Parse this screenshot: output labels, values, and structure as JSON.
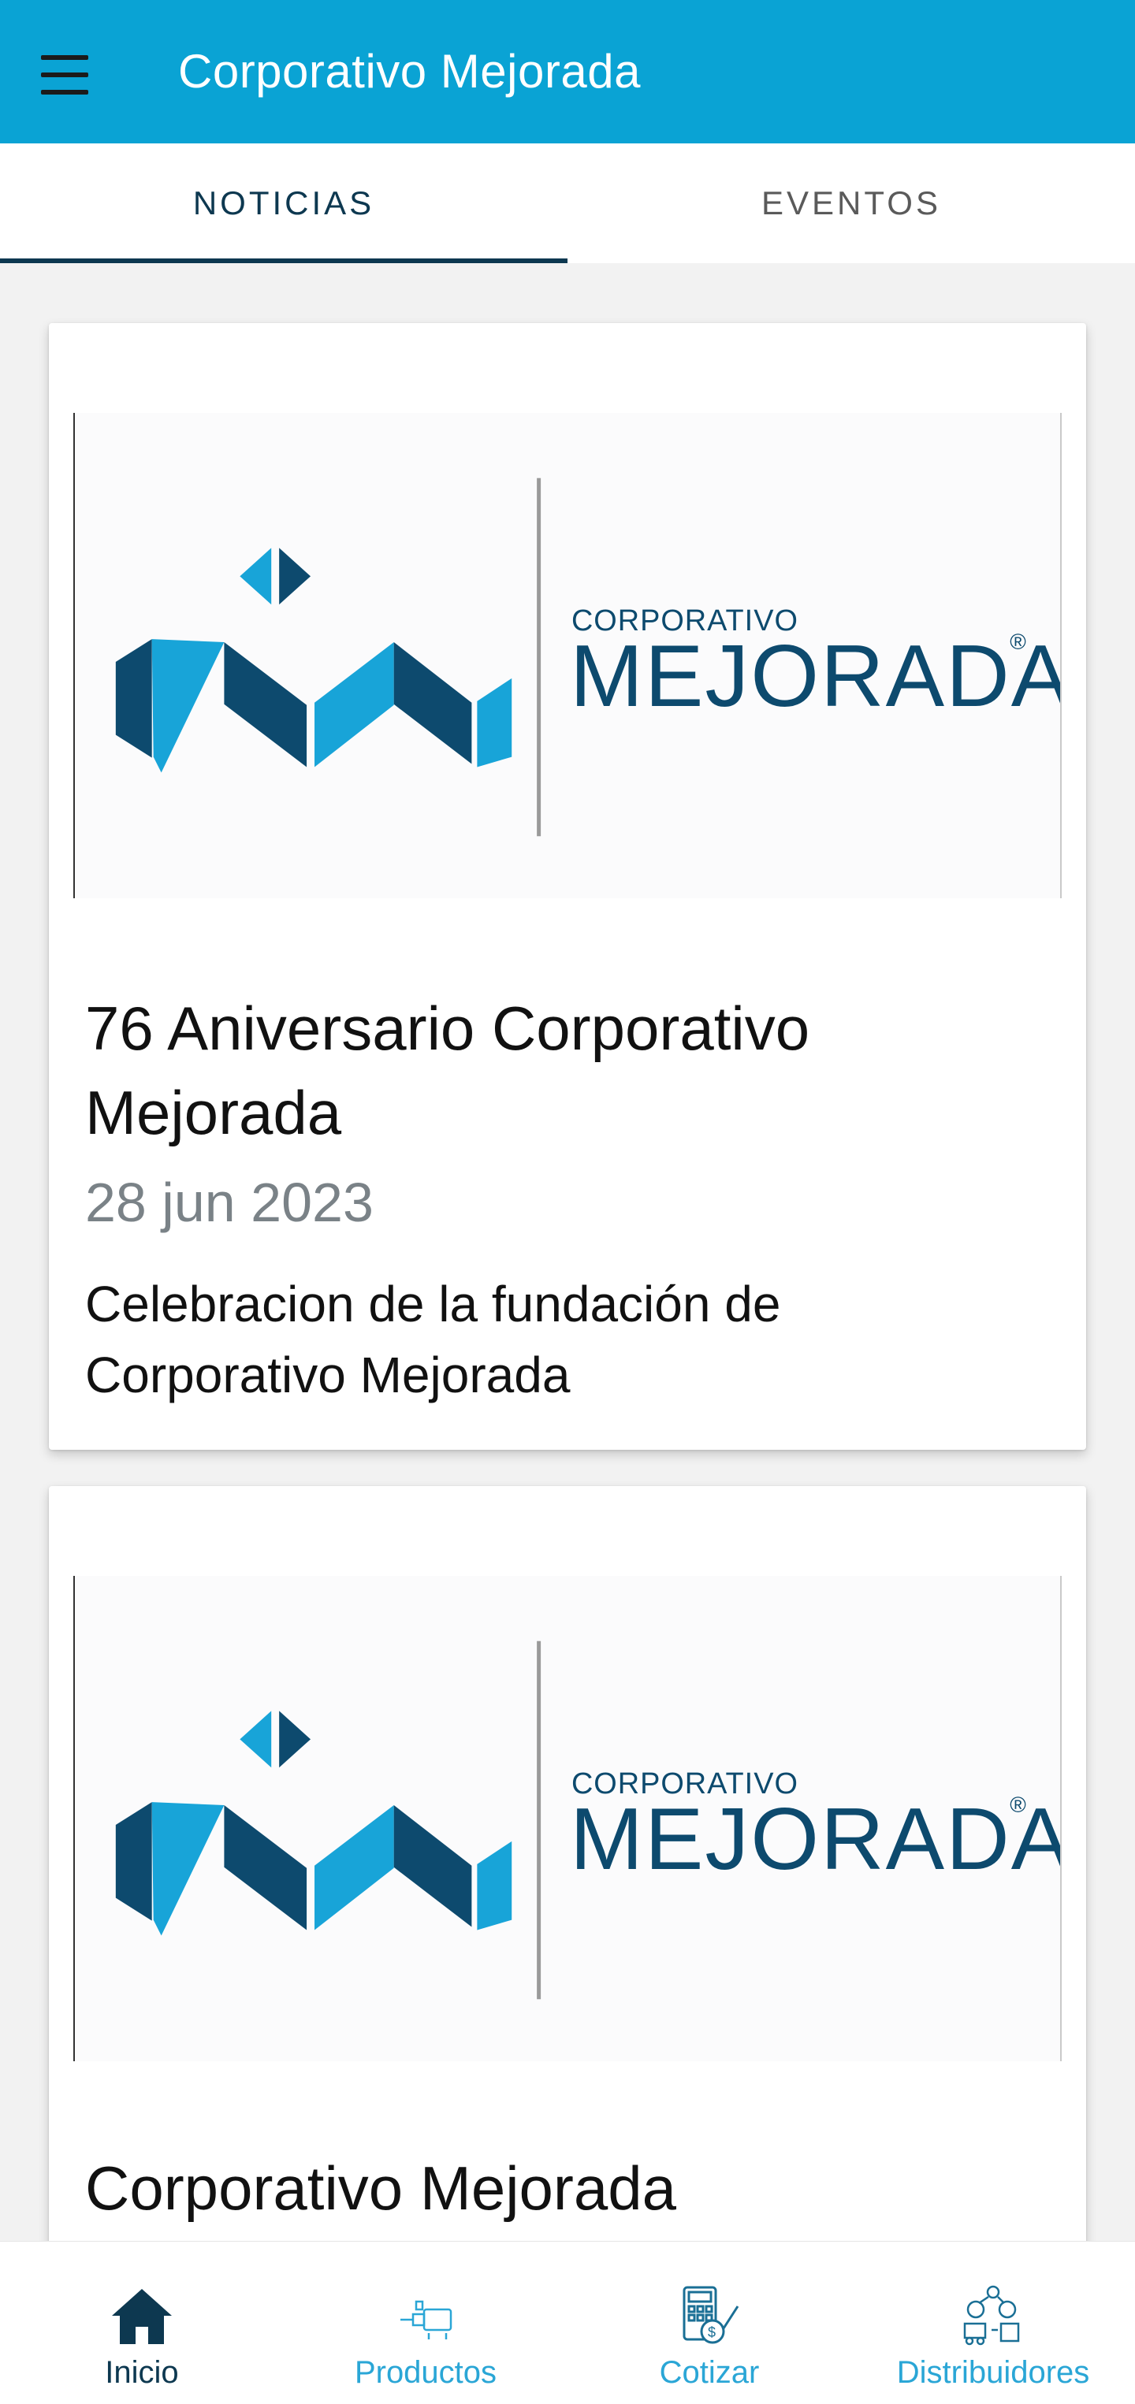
{
  "appbar": {
    "title": "Corporativo Mejorada",
    "menu_icon": "hamburger-menu-icon",
    "background_color": "#0aa3d4"
  },
  "tabs": [
    {
      "label": "NOTICIAS",
      "selected": true
    },
    {
      "label": "EVENTOS",
      "selected": false
    }
  ],
  "logo": {
    "small_text": "CORPORATIVO",
    "big_text": "MEJORADA",
    "registered": "®",
    "dark_color": "#0d4a6e",
    "light_color": "#18a4d8"
  },
  "news": [
    {
      "title": "76 Aniversario Corporativo Mejorada",
      "date": "28 jun 2023",
      "description": "Celebracion de la fundación de Corporativo Mejorada"
    },
    {
      "title": "Corporativo Mejorada"
    }
  ],
  "bottom_nav": [
    {
      "label": "Inicio",
      "icon": "home-icon",
      "active": true
    },
    {
      "label": "Productos",
      "icon": "products-icon",
      "active": false
    },
    {
      "label": "Cotizar",
      "icon": "quote-calculator-icon",
      "active": false
    },
    {
      "label": "Distribuidores",
      "icon": "distributors-icon",
      "active": false
    }
  ],
  "colors": {
    "accent": "#0aa3d4",
    "tab_active": "#0d3850",
    "nav_inactive": "#2aa6d6",
    "date_text": "#7a8287"
  }
}
